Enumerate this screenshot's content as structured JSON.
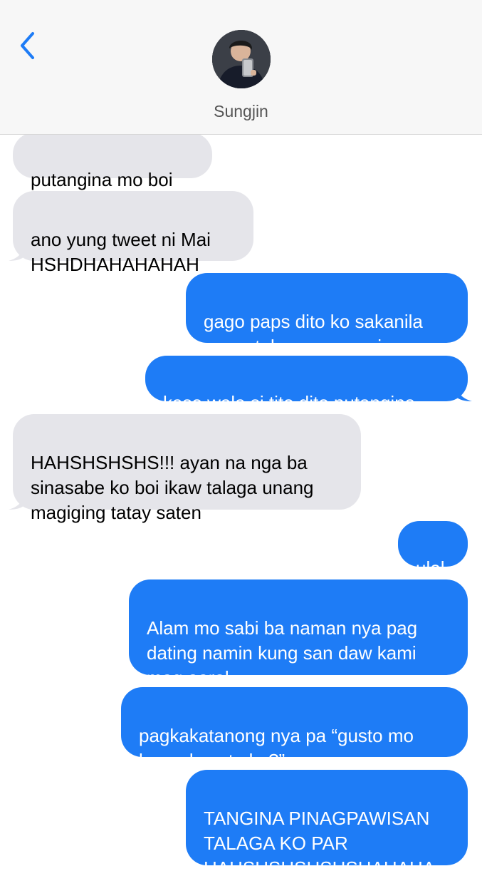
{
  "header": {
    "contact_name": "Sungjin",
    "back_icon": "chevron-left-icon",
    "colors": {
      "accent": "#1e7cf6",
      "header_bg": "#f7f7f7"
    }
  },
  "messages": [
    {
      "direction": "incoming",
      "text": "putangina mo boi"
    },
    {
      "direction": "incoming",
      "text": "ano yung tweet ni Mai\nHSHDHAHAHAHAH"
    },
    {
      "direction": "outgoing",
      "text": "gago paps dito ko sakanila\nnagpatulong mag review"
    },
    {
      "direction": "outgoing",
      "text": "kaso wala si tito dito putangina"
    },
    {
      "direction": "incoming",
      "text": "HAHSHSHSHS!!! ayan na nga ba\nsinasabe ko boi ikaw talaga unang\nmagiging tatay saten"
    },
    {
      "direction": "outgoing",
      "text": "ulol"
    },
    {
      "direction": "outgoing",
      "text": "Alam mo sabi ba naman nya pag\ndating namin kung san daw kami\nmag aaral"
    },
    {
      "direction": "outgoing",
      "text": "pagkakatanong nya pa “gusto mo\nba sa kwarto ko?”"
    },
    {
      "direction": "outgoing",
      "text": "TANGINA PINAGPAWISAN\nTALAGA KO PAR\nHAHSHSHSHSHSHAHAHA"
    }
  ],
  "bubble_colors": {
    "incoming": "#e5e5ea",
    "outgoing": "#1e7cf6"
  }
}
